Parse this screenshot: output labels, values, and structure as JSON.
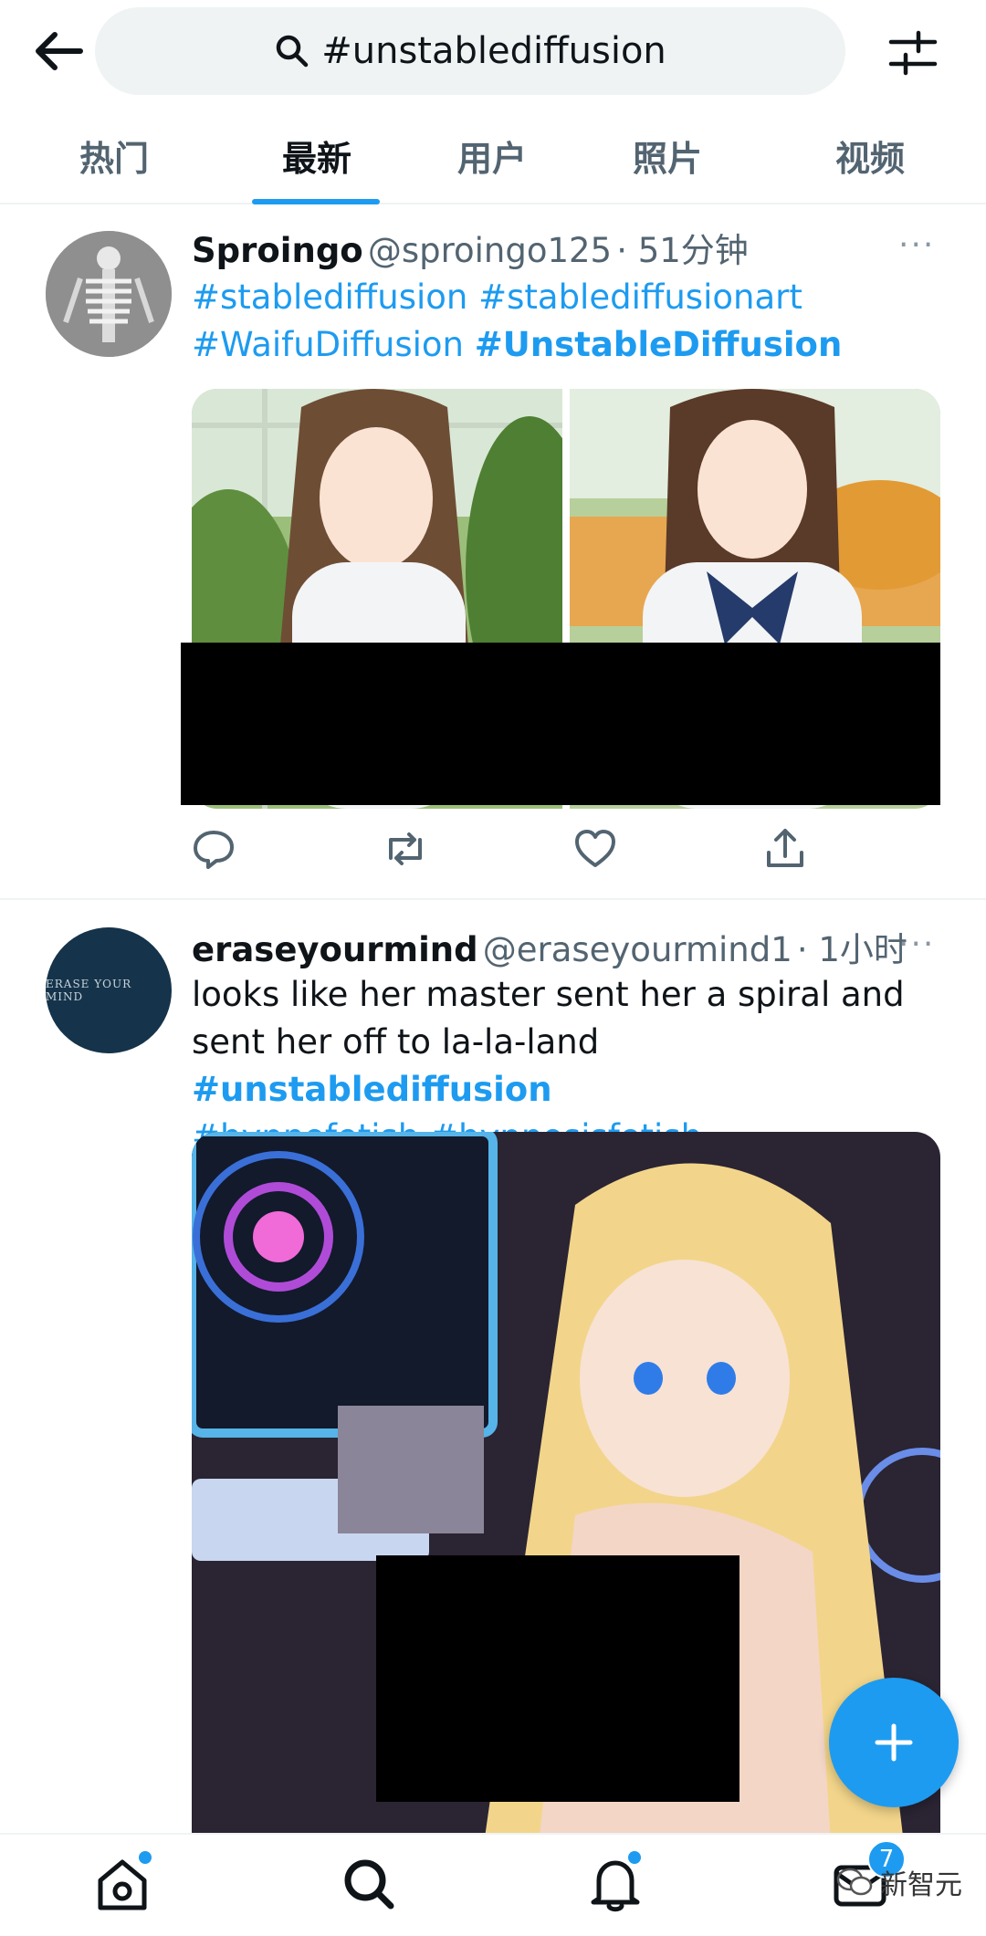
{
  "header": {
    "search_query": "#unstablediffusion"
  },
  "tabs": [
    {
      "label": "热门",
      "active": false
    },
    {
      "label": "最新",
      "active": true
    },
    {
      "label": "用户",
      "active": false
    },
    {
      "label": "照片",
      "active": false
    },
    {
      "label": "视频",
      "active": false
    }
  ],
  "tweets": [
    {
      "name": "Sproingo",
      "handle": "@sproingo125",
      "time": "· 51分钟",
      "more": "···",
      "text_parts": [
        {
          "text": "#stablediffusion",
          "style": "tag"
        },
        {
          "text": " ",
          "style": "plain"
        },
        {
          "text": "#stablediffusionart",
          "style": "tag"
        },
        {
          "text": " ",
          "style": "plain"
        },
        {
          "text": "#WaifuDiffusion",
          "style": "tag"
        },
        {
          "text": " ",
          "style": "plain"
        },
        {
          "text": "#UnstableDiffusion",
          "style": "tag-bold"
        }
      ]
    },
    {
      "name": "eraseyourmind",
      "handle": "@eraseyourmind1",
      "time": "· 1小时",
      "more": "···",
      "avatar_text": "ERASE YOUR MIND",
      "text_parts": [
        {
          "text": "looks like her master sent her a spiral and sent her off to la-la-land ",
          "style": "plain"
        },
        {
          "text": "#unstablediffusion",
          "style": "tag-bold"
        },
        {
          "text": " ",
          "style": "plain"
        },
        {
          "text": "#hypnofetish",
          "style": "tag"
        },
        {
          "text": " ",
          "style": "plain"
        },
        {
          "text": "#hypnosisfetish",
          "style": "tag"
        }
      ]
    }
  ],
  "bottom_nav": {
    "notification_badge": "7",
    "watermark": "新智元"
  },
  "colors": {
    "accent": "#1d9bf0",
    "text_primary": "#0f1419",
    "text_secondary": "#536471"
  },
  "icons": [
    "back-arrow-icon",
    "search-icon",
    "filter-icon",
    "reply-icon",
    "retweet-icon",
    "like-icon",
    "share-icon",
    "compose-plus-icon",
    "home-icon",
    "explore-search-icon",
    "notifications-bell-icon",
    "messages-icon"
  ]
}
